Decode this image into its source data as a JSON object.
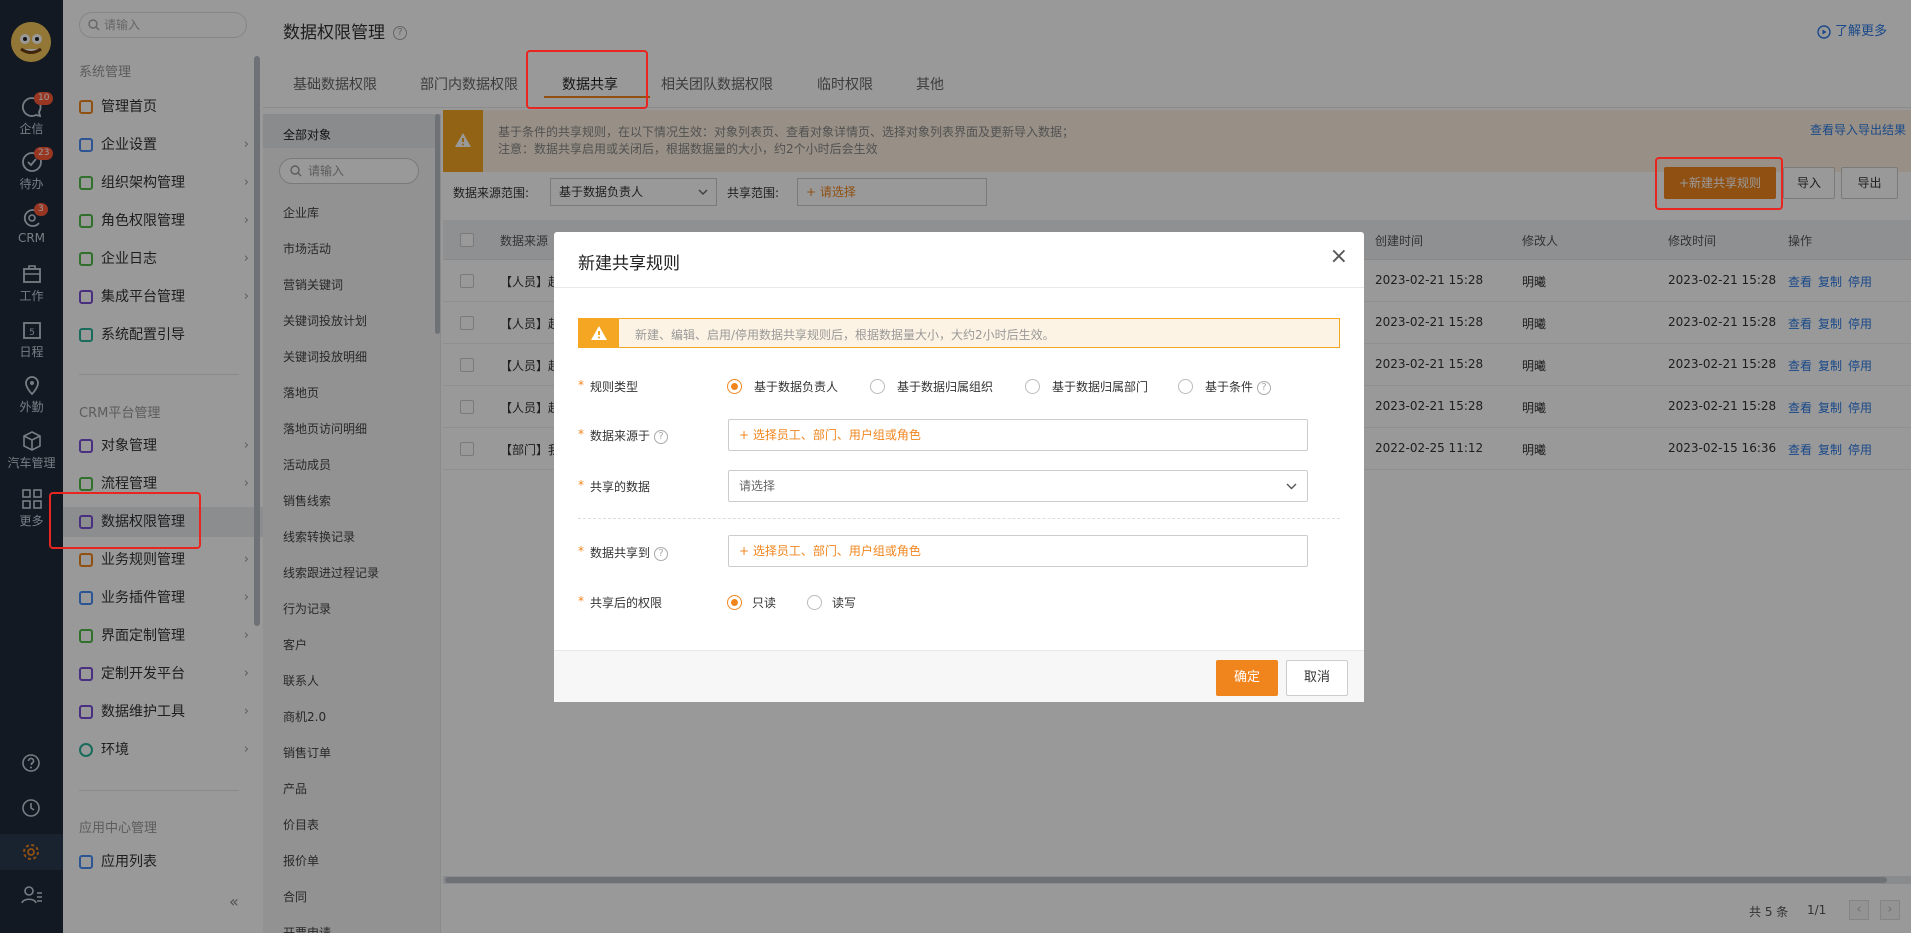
{
  "rail": {
    "items": [
      {
        "label": "企信",
        "icon": "chat-icon",
        "badge": "10"
      },
      {
        "label": "待办",
        "icon": "check-circle-icon",
        "badge": "23"
      },
      {
        "label": "CRM",
        "icon": "crm-icon",
        "badge": "3"
      },
      {
        "label": "工作",
        "icon": "briefcase-icon"
      },
      {
        "label": "日程",
        "icon": "calendar-icon",
        "day": "5"
      },
      {
        "label": "外勤",
        "icon": "location-pin-icon"
      },
      {
        "label": "汽车管理",
        "icon": "cube-icon"
      },
      {
        "label": "更多",
        "icon": "grid-icon"
      }
    ]
  },
  "nav": {
    "search_placeholder": "请输入",
    "section1": "系统管理",
    "items1": [
      {
        "label": "管理首页",
        "chev": ""
      },
      {
        "label": "企业设置",
        "chev": "›"
      },
      {
        "label": "组织架构管理",
        "chev": "›"
      },
      {
        "label": "角色权限管理",
        "chev": "›"
      },
      {
        "label": "企业日志",
        "chev": "›"
      },
      {
        "label": "集成平台管理",
        "chev": "›"
      },
      {
        "label": "系统配置引导",
        "chev": ""
      }
    ],
    "section2": "CRM平台管理",
    "items2": [
      {
        "label": "对象管理",
        "chev": "›"
      },
      {
        "label": "流程管理",
        "chev": "›"
      },
      {
        "label": "数据权限管理",
        "chev": ""
      },
      {
        "label": "业务规则管理",
        "chev": "›"
      },
      {
        "label": "业务插件管理",
        "chev": "›"
      },
      {
        "label": "界面定制管理",
        "chev": "›"
      },
      {
        "label": "定制开发平台",
        "chev": "›"
      },
      {
        "label": "数据维护工具",
        "chev": "›"
      },
      {
        "label": "环境",
        "chev": "›"
      }
    ],
    "section3": "应用中心管理",
    "items3": [
      {
        "label": "应用列表",
        "chev": ""
      }
    ],
    "collapse": "«"
  },
  "header": {
    "title": "数据权限管理",
    "learn_more": "了解更多"
  },
  "tabs": [
    "基础数据权限",
    "部门内数据权限",
    "数据共享",
    "相关团队数据权限",
    "临时权限",
    "其他"
  ],
  "objects": {
    "search_placeholder": "请输入",
    "items": [
      "全部对象",
      "企业库",
      "市场活动",
      "营销关键词",
      "关键词投放计划",
      "关键词投放明细",
      "落地页",
      "落地页访问明细",
      "活动成员",
      "销售线索",
      "线索转换记录",
      "线索跟进过程记录",
      "行为记录",
      "客户",
      "联系人",
      "商机2.0",
      "销售订单",
      "产品",
      "价目表",
      "报价单",
      "合同",
      "开票申请"
    ]
  },
  "banner": {
    "line1": "基于条件的共享规则，在以下情况生效：对象列表页、查看对象详情页、选择对象列表界面及更新导入数据；",
    "line2": "注意：数据共享启用或关闭后，根据数据量的大小，约2个小时后会生效",
    "link": "查看导入导出结果"
  },
  "filters": {
    "source_label": "数据来源范围:",
    "source_value": "基于数据负责人",
    "scope_label": "共享范围:",
    "scope_value": "+ 请选择"
  },
  "actions": {
    "new_rule": "+新建共享规则",
    "import": "导入",
    "export": "导出"
  },
  "table": {
    "headers": [
      "数据来源",
      "创建时间",
      "修改人",
      "修改时间",
      "操作"
    ],
    "rows": [
      {
        "source": "【人员】赵",
        "created": "2023-02-21 15:28",
        "modifier": "明曦",
        "modified": "2023-02-21 15:28"
      },
      {
        "source": "【人员】赵",
        "created": "2023-02-21 15:28",
        "modifier": "明曦",
        "modified": "2023-02-21 15:28"
      },
      {
        "source": "【人员】赵",
        "created": "2023-02-21 15:28",
        "modifier": "明曦",
        "modified": "2023-02-21 15:28"
      },
      {
        "source": "【人员】赵",
        "created": "2023-02-21 15:28",
        "modifier": "明曦",
        "modified": "2023-02-21 15:28"
      },
      {
        "source": "【部门】我",
        "created": "2022-02-25 11:12",
        "modifier": "明曦",
        "modified": "2023-02-15 16:36"
      }
    ],
    "ops": [
      "查看",
      "复制",
      "停用"
    ]
  },
  "pagination": {
    "total": "共 5 条",
    "pages": "1/1",
    "prev": "‹",
    "next": "›"
  },
  "modal": {
    "title": "新建共享规则",
    "close": "×",
    "warning": "新建、编辑、启用/停用数据共享规则后，根据数据量大小，大约2小时后生效。",
    "rule_type_label": "规则类型",
    "rule_types": [
      "基于数据负责人",
      "基于数据归属组织",
      "基于数据归属部门",
      "基于条件"
    ],
    "source_label": "数据来源于",
    "source_placeholder": "+ 选择员工、部门、用户组或角色",
    "shared_data_label": "共享的数据",
    "shared_data_placeholder": "请选择",
    "share_to_label": "数据共享到",
    "share_to_placeholder": "+ 选择员工、部门、用户组或角色",
    "permission_label": "共享后的权限",
    "permissions": [
      "只读",
      "读写"
    ],
    "confirm": "确定",
    "cancel": "取消",
    "help": "?",
    "star": "*"
  },
  "colors": {
    "accent": "#f0851e",
    "link": "#2c7be5",
    "rail": "#1e2a3b",
    "highlight": "#e8251f"
  }
}
